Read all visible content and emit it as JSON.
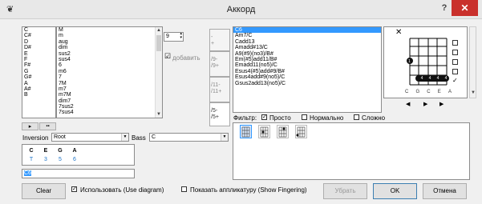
{
  "window": {
    "title": "Аккорд",
    "help": "?",
    "close": "✕"
  },
  "roots": [
    "C",
    "C#",
    "D",
    "D#",
    "E",
    "F",
    "F#",
    "G",
    "G#",
    "A",
    "A#",
    "B"
  ],
  "types": [
    "M",
    "m",
    "aug",
    "dim",
    "sus2",
    "sus4",
    "6",
    "m6",
    "7",
    "7M",
    "m7",
    "m7M",
    "dim7",
    "7sus2",
    "7sus4"
  ],
  "spinner_value": "9",
  "add_checkbox": {
    "checked": "☑",
    "label": "добавить"
  },
  "side_tabs": [
    "-\n+",
    "/9-\n/9+",
    "/11-\n/11+",
    "/5-\n/5+"
  ],
  "chords": [
    "C6",
    "Am7/C",
    "Cadd13",
    "Amadd#13/C",
    "A9(#9)(no3)/B#",
    "Em(#5)add11/B#",
    "Emadd11(no5)/C",
    "Esus4(#5)add#9/B#",
    "Esus4add#9(no5)/C",
    "Gsus2add13(no5)/C"
  ],
  "diagram": {
    "string_names": [
      "C",
      "G",
      "C",
      "E",
      "A"
    ],
    "barre_labels": [
      "4",
      "4",
      "4",
      "4"
    ],
    "muted": "✕",
    "dot": "1"
  },
  "nav": {
    "prev": "◀",
    "play": "▶",
    "next": "▶"
  },
  "filter": {
    "label": "Фильтр:",
    "simple": "Просто",
    "normal": "Нормально",
    "hard": "Сложно"
  },
  "bottom_small_buttons": [
    "▸",
    "▪▪"
  ],
  "inversion": {
    "label": "Inversion",
    "value": "Root"
  },
  "bass": {
    "label": "Bass",
    "value": "C"
  },
  "notes": [
    "C",
    "E",
    "G",
    "A"
  ],
  "intervals": [
    "T",
    "3",
    "5",
    "6"
  ],
  "name_field": "C6",
  "buttons": {
    "clear": "Clear",
    "use_diagram": "Использовать (Use diagram)",
    "show_fingering": "Показать аппликатуру (Show Fingering)",
    "remove": "Убрать",
    "ok": "OK",
    "cancel": "Отмена"
  },
  "accent": "#3399ff"
}
